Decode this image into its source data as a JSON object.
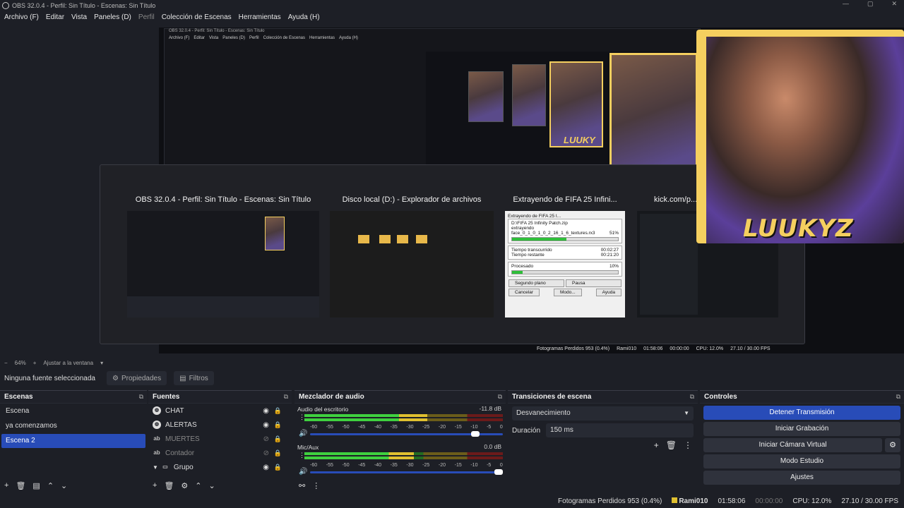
{
  "window": {
    "title": "OBS 32.0.4 - Perfil: Sin Título - Escenas: Sin Título",
    "min": "—",
    "max": "▢",
    "close": "✕"
  },
  "menu": {
    "items": [
      "Archivo (F)",
      "Editar",
      "Vista",
      "Paneles (D)",
      "Perfil",
      "Colección de Escenas",
      "Herramientas",
      "Ayuda (H)"
    ]
  },
  "nested": {
    "title": "OBS 32.0.4 - Perfil: Sin Título - Escenas: Sin Título",
    "menu": [
      "Archivo (F)",
      "Editar",
      "Vista",
      "Paneles (D)",
      "Perfil",
      "Colección de Escenas",
      "Herramientas",
      "Ayuda (H)"
    ],
    "brand_small": "LUUKY"
  },
  "switcher": {
    "windows": [
      {
        "title": "OBS 32.0.4 - Perfil: Sin Título - Escenas: Sin Título"
      },
      {
        "title": "Disco local (D:) - Explorador de archivos"
      },
      {
        "title": "Extrayendo de FIFA 25 Infini..."
      },
      {
        "title": "kick.com/p..."
      }
    ],
    "extract": {
      "header": "Extrayendo de FIFA 25 I...",
      "path": "D:\\FIFA 25 Infinity Patch.zip",
      "action": "extrayendo",
      "file": "face_0_1_0_1_0_2_16_1_6_textures.rx3",
      "file_pct": "51%",
      "file_progress": 0.51,
      "elapsed_label": "Tiempo transcurrido",
      "elapsed": "00:02:27",
      "remaining_label": "Tiempo restante",
      "remaining": "00:21:20",
      "processed_label": "Procesado",
      "processed_pct": "10%",
      "processed_progress": 0.1,
      "btn_bg": "Segundo plano",
      "btn_pause": "Pausa",
      "btn_cancel": "Cancelar",
      "btn_mode": "Modo...",
      "btn_help": "Ayuda"
    }
  },
  "camera": {
    "brand": "LUUKYZ",
    "accent": "#f5cf5f"
  },
  "preview_status": {
    "dropped": "Fotogramas Perdidos 953 (0.4%)",
    "user": "Rami010",
    "time": "01:58:06",
    "rec": "00:00:00",
    "cpu": "CPU: 12.0%",
    "fps": "27.10 / 30.00 FPS"
  },
  "zoom": {
    "minus": "−",
    "value": "64%",
    "plus": "+",
    "fit": "Ajustar a la ventana",
    "caret": "▾"
  },
  "context": {
    "source": "Ninguna fuente seleccionada",
    "properties": "Propiedades",
    "filters": "Filtros"
  },
  "scenes": {
    "title": "Escenas",
    "items": [
      {
        "label": "Escena"
      },
      {
        "label": "ya comenzamos"
      },
      {
        "label": "Escena 2"
      }
    ],
    "selected": "Escena 2"
  },
  "sources": {
    "title": "Fuentes",
    "items": [
      {
        "label": "CHAT",
        "icon": "globe-icon",
        "visible": true
      },
      {
        "label": "ALERTAS",
        "icon": "globe-icon",
        "visible": true
      },
      {
        "label": "MUERTES",
        "icon": "text-icon",
        "visible": false
      },
      {
        "label": "Contador",
        "icon": "text-icon",
        "visible": false
      },
      {
        "label": "Grupo",
        "icon": "folder-icon",
        "visible": true
      }
    ]
  },
  "mixer": {
    "title": "Mezclador de audio",
    "channels": [
      {
        "name": "Audio del escritorio",
        "db": "-11.8 dB",
        "level": 0.62,
        "volume": 0.88
      },
      {
        "name": "Mic/Aux",
        "db": "0.0 dB",
        "level": 0.55,
        "volume": 1.0
      }
    ],
    "scale": [
      "-60",
      "-55",
      "-50",
      "-45",
      "-40",
      "-35",
      "-30",
      "-25",
      "-20",
      "-15",
      "-10",
      "-5",
      "0"
    ]
  },
  "transitions": {
    "title": "Transiciones de escena",
    "selected": "Desvanecimiento",
    "duration_label": "Duración",
    "duration": "150 ms"
  },
  "controls": {
    "title": "Controles",
    "stop_stream": "Detener Transmisión",
    "start_record": "Iniciar Grabación",
    "start_vcam": "Iniciar Cámara Virtual",
    "studio": "Modo Estudio",
    "settings": "Ajustes"
  },
  "statusbar": {
    "dropped": "Fotogramas Perdidos 953 (0.4%)",
    "user": "Rami010",
    "time": "01:58:06",
    "rec": "00:00:00",
    "cpu": "CPU: 12.0%",
    "fps": "27.10 / 30.00 FPS"
  }
}
